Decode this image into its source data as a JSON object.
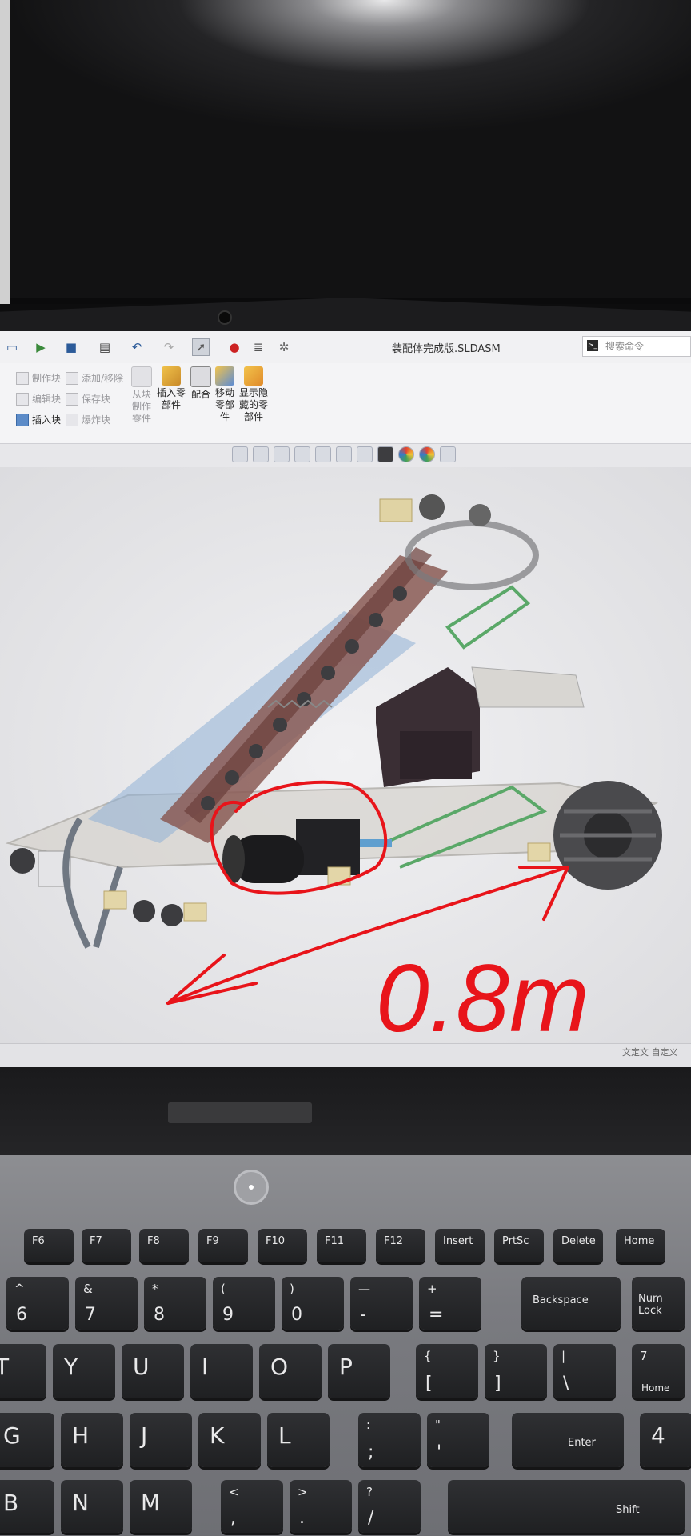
{
  "window": {
    "title": "装配体完成版.SLDASM",
    "search_placeholder": "搜索命令"
  },
  "ribbon": {
    "small_col1": [
      "制作块",
      "编辑块",
      "插入块"
    ],
    "small_col2": [
      "添加/移除",
      "保存块",
      "爆炸块"
    ],
    "big_buttons": [
      {
        "lines": [
          "从块",
          "制作",
          "零件"
        ],
        "enabled": false
      },
      {
        "lines": [
          "插入零",
          "部件"
        ],
        "enabled": true
      },
      {
        "lines": [
          "配合"
        ],
        "enabled": true
      },
      {
        "lines": [
          "移动",
          "零部",
          "件"
        ],
        "enabled": true
      },
      {
        "lines": [
          "显示隐",
          "藏的零",
          "部件"
        ],
        "enabled": true
      }
    ]
  },
  "status": {
    "text": "文定文 自定义"
  },
  "annotation": {
    "handwritten_text": "0.8m",
    "stroke_color": "#e8141a"
  },
  "keyboard": {
    "function_row": [
      "F6",
      "F7",
      "F8",
      "F9",
      "F10",
      "F11",
      "F12",
      "Insert",
      "PrtSc",
      "Delete",
      "Home"
    ],
    "number_row": [
      {
        "top": "^",
        "bottom": "6"
      },
      {
        "top": "&",
        "bottom": "7"
      },
      {
        "top": "*",
        "bottom": "8"
      },
      {
        "top": "(",
        "bottom": "9"
      },
      {
        "top": ")",
        "bottom": "0"
      },
      {
        "top": "—",
        "bottom": "-"
      },
      {
        "top": "+",
        "bottom": "="
      }
    ],
    "backspace": "Backspace",
    "numlock": [
      "Num",
      "Lock"
    ],
    "row_t": [
      "T",
      "Y",
      "U",
      "I",
      "O",
      "P"
    ],
    "bracket_keys": [
      {
        "top": "{",
        "bottom": "["
      },
      {
        "top": "}",
        "bottom": "]"
      },
      {
        "top": "|",
        "bottom": "\\"
      }
    ],
    "numpad_7": {
      "top": "7",
      "bottom": "Home"
    },
    "row_g": [
      "G",
      "H",
      "J",
      "K",
      "L"
    ],
    "semicolon": {
      "top": ":",
      "bottom": ";"
    },
    "quote": {
      "top": "\"",
      "bottom": "'"
    },
    "enter": "Enter",
    "numpad_4": "4",
    "row_b": [
      "B",
      "N",
      "M"
    ],
    "comma": {
      "top": "<",
      "bottom": ","
    },
    "period": {
      "top": ">",
      "bottom": "."
    },
    "slash": {
      "top": "?",
      "bottom": "/"
    },
    "shift": "Shift"
  },
  "colors": {
    "accent": "#2c5b99",
    "annotation_red": "#e8141a"
  }
}
